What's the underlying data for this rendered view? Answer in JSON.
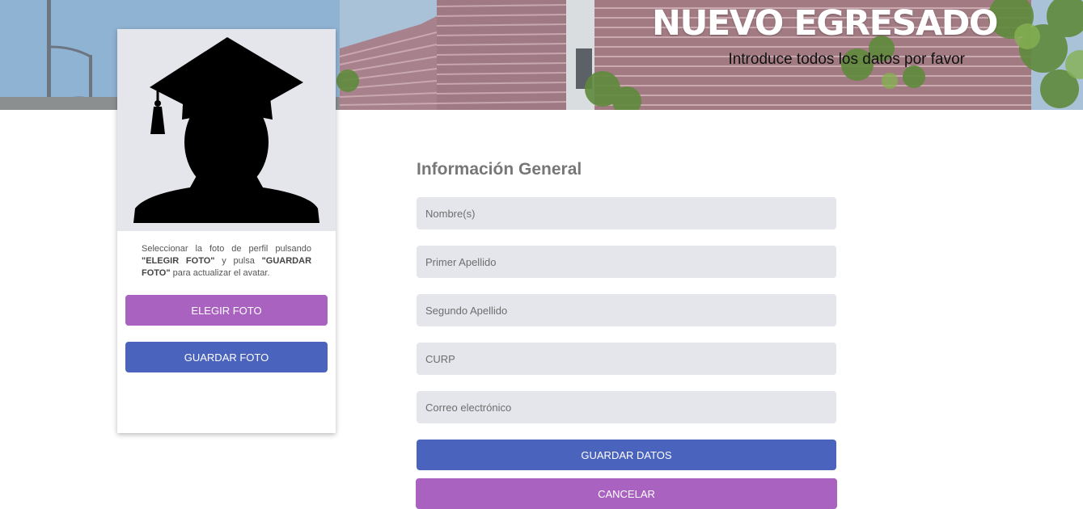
{
  "header": {
    "title": "NUEVO EGRESADO",
    "subtitle": "Introduce todos los datos por favor"
  },
  "profile": {
    "avatar_icon": "graduate-silhouette-icon",
    "help_part1": "Seleccionar la foto de perfil pulsando ",
    "help_bold1": "\"ELEGIR FOTO\"",
    "help_part2": " y pulsa ",
    "help_bold2": "\"GUARDAR FOTO\"",
    "help_part3": " para actualizar el avatar.",
    "choose_label": "ELEGIR FOTO",
    "save_photo_label": "GUARDAR FOTO"
  },
  "form": {
    "title": "Información General",
    "fields": [
      {
        "placeholder": "Nombre(s)",
        "value": ""
      },
      {
        "placeholder": "Primer Apellido",
        "value": ""
      },
      {
        "placeholder": "Segundo Apellido",
        "value": ""
      },
      {
        "placeholder": "CURP",
        "value": ""
      },
      {
        "placeholder": "Correo electrónico",
        "value": ""
      }
    ],
    "save_label": "GUARDAR DATOS",
    "cancel_label": "CANCELAR"
  },
  "colors": {
    "purple": "#aa62c0",
    "blue": "#4a63bd",
    "field_bg": "#e5e5ec"
  }
}
